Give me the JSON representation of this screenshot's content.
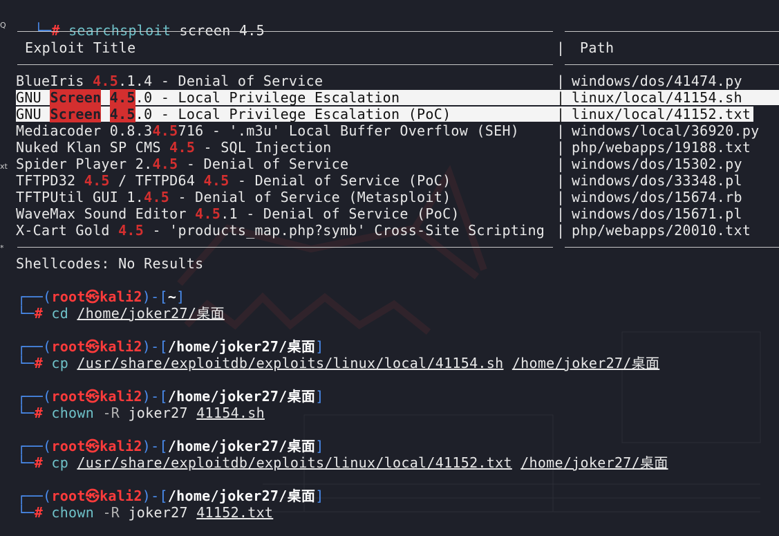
{
  "command": {
    "prompt_hash": "#",
    "program": "searchsploit",
    "args": "screen 4.5"
  },
  "headers": {
    "title": "Exploit Title",
    "path": "Path",
    "divider": "|"
  },
  "exploits": [
    {
      "segments": [
        {
          "t": "BlueIris ",
          "s": ""
        },
        {
          "t": "4.5",
          "s": "red"
        },
        {
          "t": ".1.4 - Denial of Service",
          "s": ""
        }
      ],
      "path": "windows/dos/41474.py",
      "highlighted": false
    },
    {
      "segments": [
        {
          "t": "GNU ",
          "s": ""
        },
        {
          "t": "Screen",
          "s": "redbg"
        },
        {
          "t": " ",
          "s": ""
        },
        {
          "t": "4.5",
          "s": "redbg"
        },
        {
          "t": ".0 - Local Privilege Escalation",
          "s": ""
        }
      ],
      "path": "linux/local/41154.sh",
      "highlighted": true
    },
    {
      "segments": [
        {
          "t": "GNU ",
          "s": ""
        },
        {
          "t": "Screen",
          "s": "redbg"
        },
        {
          "t": " ",
          "s": ""
        },
        {
          "t": "4.5",
          "s": "redbg"
        },
        {
          "t": ".0 - Local Privilege Escalation (PoC)",
          "s": ""
        }
      ],
      "path": "linux/local/41152.txt",
      "highlighted": true
    },
    {
      "segments": [
        {
          "t": "Mediacoder 0.8.3",
          "s": ""
        },
        {
          "t": "4.5",
          "s": "red"
        },
        {
          "t": "716 - '.m3u' Local Buffer Overflow (SEH)",
          "s": ""
        }
      ],
      "path": "windows/local/36920.py",
      "highlighted": false
    },
    {
      "segments": [
        {
          "t": "Nuked Klan SP CMS ",
          "s": ""
        },
        {
          "t": "4.5",
          "s": "red"
        },
        {
          "t": " - SQL Injection",
          "s": ""
        }
      ],
      "path": "php/webapps/19188.txt",
      "highlighted": false
    },
    {
      "segments": [
        {
          "t": "Spider Player 2.",
          "s": ""
        },
        {
          "t": "4.5",
          "s": "red"
        },
        {
          "t": " - Denial of Service",
          "s": ""
        }
      ],
      "path": "windows/dos/15302.py",
      "highlighted": false
    },
    {
      "segments": [
        {
          "t": "TFTPD32 ",
          "s": ""
        },
        {
          "t": "4.5",
          "s": "red"
        },
        {
          "t": " / TFTPD64 ",
          "s": ""
        },
        {
          "t": "4.5",
          "s": "red"
        },
        {
          "t": " - Denial of Service (PoC)",
          "s": ""
        }
      ],
      "path": "windows/dos/33348.pl",
      "highlighted": false
    },
    {
      "segments": [
        {
          "t": "TFTPUtil GUI 1.",
          "s": ""
        },
        {
          "t": "4.5",
          "s": "red"
        },
        {
          "t": " - Denial of Service (Metasploit)",
          "s": ""
        }
      ],
      "path": "windows/dos/15674.rb",
      "highlighted": false
    },
    {
      "segments": [
        {
          "t": "WaveMax Sound Editor ",
          "s": ""
        },
        {
          "t": "4.5",
          "s": "red"
        },
        {
          "t": ".1 - Denial of Service (PoC)",
          "s": ""
        }
      ],
      "path": "windows/dos/15671.pl",
      "highlighted": false
    },
    {
      "segments": [
        {
          "t": "X-Cart Gold ",
          "s": ""
        },
        {
          "t": "4.5",
          "s": "red"
        },
        {
          "t": " - 'products_map.php?symb' Cross-Site Scripting",
          "s": ""
        }
      ],
      "path": "php/webapps/20010.txt",
      "highlighted": false
    }
  ],
  "shellcodes": "Shellcodes: No Results",
  "prompts": [
    {
      "user": "root",
      "at": "㉿",
      "host": "kali2",
      "dir": "~",
      "cmd": "cd",
      "args": [
        {
          "t": "/home/joker27/桌面",
          "u": true
        }
      ]
    },
    {
      "user": "root",
      "at": "㉿",
      "host": "kali2",
      "dir": "/home/joker27/桌面",
      "cmd": "cp",
      "args": [
        {
          "t": "/usr/share/exploitdb/exploits/linux/local/41154.sh",
          "u": true
        },
        {
          "t": "/home/joker27/桌面",
          "u": true
        }
      ]
    },
    {
      "user": "root",
      "at": "㉿",
      "host": "kali2",
      "dir": "/home/joker27/桌面",
      "cmd": "chown",
      "args": [
        {
          "t": "-R",
          "u": false,
          "opt": true
        },
        {
          "t": "joker27",
          "u": false
        },
        {
          "t": "41154.sh",
          "u": true
        }
      ]
    },
    {
      "user": "root",
      "at": "㉿",
      "host": "kali2",
      "dir": "/home/joker27/桌面",
      "cmd": "cp",
      "args": [
        {
          "t": "/usr/share/exploitdb/exploits/linux/local/41152.txt",
          "u": true
        },
        {
          "t": "/home/joker27/桌面",
          "u": true
        }
      ]
    },
    {
      "user": "root",
      "at": "㉿",
      "host": "kali2",
      "dir": "/home/joker27/桌面",
      "cmd": "chown",
      "args": [
        {
          "t": "-R",
          "u": false,
          "opt": true
        },
        {
          "t": "joker27",
          "u": false
        },
        {
          "t": "41152.txt",
          "u": true
        }
      ]
    }
  ],
  "edge_fragments": [
    "Q",
    "xt",
    "*"
  ]
}
